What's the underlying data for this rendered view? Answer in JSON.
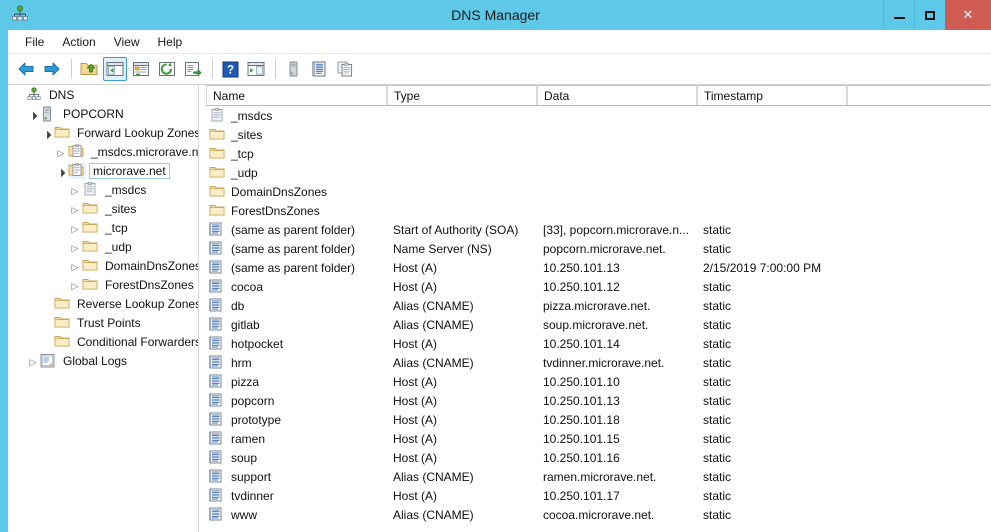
{
  "window": {
    "title": "DNS Manager",
    "app_icon": "dns-server-icon",
    "controls": {
      "minimize": "–",
      "maximize": "□",
      "close": "✕"
    },
    "accent_color": "#5ec8e8",
    "close_color": "#cf5b52"
  },
  "menubar": {
    "items": [
      {
        "label": "File",
        "name": "menu-file"
      },
      {
        "label": "Action",
        "name": "menu-action"
      },
      {
        "label": "View",
        "name": "menu-view"
      },
      {
        "label": "Help",
        "name": "menu-help"
      }
    ]
  },
  "toolbar": {
    "buttons": [
      {
        "name": "back-icon",
        "icon": "arrow-left",
        "active": false
      },
      {
        "name": "forward-icon",
        "icon": "arrow-right",
        "active": false
      },
      {
        "name": "separator-1",
        "icon": "separator",
        "active": false
      },
      {
        "name": "up-one-level-icon",
        "icon": "folder-up",
        "active": false
      },
      {
        "name": "show-hide-console-tree-icon",
        "icon": "console-tree",
        "active": true
      },
      {
        "name": "properties-icon",
        "icon": "properties",
        "active": false
      },
      {
        "name": "refresh-icon",
        "icon": "refresh",
        "active": false
      },
      {
        "name": "export-list-icon",
        "icon": "export-list",
        "active": false
      },
      {
        "name": "separator-2",
        "icon": "separator",
        "active": false
      },
      {
        "name": "help-icon",
        "icon": "help",
        "active": false
      },
      {
        "name": "show-hide-action-pane-icon",
        "icon": "action-pane",
        "active": false
      },
      {
        "name": "separator-3",
        "icon": "separator",
        "active": false
      },
      {
        "name": "new-server-icon",
        "icon": "server",
        "active": false
      },
      {
        "name": "new-record-icon",
        "icon": "record",
        "active": false
      },
      {
        "name": "copy-icon",
        "icon": "copy",
        "active": false
      }
    ]
  },
  "tree": {
    "items": [
      {
        "label": "DNS",
        "depth": 0,
        "arrow": "none",
        "icon": "dns-root-icon",
        "selected": false,
        "name": "tree-item-dns"
      },
      {
        "label": "POPCORN",
        "depth": 1,
        "arrow": "open",
        "icon": "server-icon",
        "selected": false,
        "name": "tree-item-popcorn"
      },
      {
        "label": "Forward Lookup Zones",
        "depth": 2,
        "arrow": "open",
        "icon": "folder-icon",
        "selected": false,
        "name": "tree-item-forward-lookup-zones"
      },
      {
        "label": "_msdcs.microrave.net",
        "depth": 3,
        "arrow": "closed",
        "icon": "zone-icon",
        "selected": false,
        "name": "tree-item-msdcs-microrave-net"
      },
      {
        "label": "microrave.net",
        "depth": 3,
        "arrow": "open",
        "icon": "zone-icon",
        "selected": true,
        "name": "tree-item-microrave-net"
      },
      {
        "label": "_msdcs",
        "depth": 4,
        "arrow": "closed",
        "icon": "zone-gray-icon",
        "selected": false,
        "name": "tree-item-msdcs"
      },
      {
        "label": "_sites",
        "depth": 4,
        "arrow": "closed",
        "icon": "folder-icon",
        "selected": false,
        "name": "tree-item-sites"
      },
      {
        "label": "_tcp",
        "depth": 4,
        "arrow": "closed",
        "icon": "folder-icon",
        "selected": false,
        "name": "tree-item-tcp"
      },
      {
        "label": "_udp",
        "depth": 4,
        "arrow": "closed",
        "icon": "folder-icon",
        "selected": false,
        "name": "tree-item-udp"
      },
      {
        "label": "DomainDnsZones",
        "depth": 4,
        "arrow": "closed",
        "icon": "folder-icon",
        "selected": false,
        "name": "tree-item-domaindnszones"
      },
      {
        "label": "ForestDnsZones",
        "depth": 4,
        "arrow": "closed",
        "icon": "folder-icon",
        "selected": false,
        "name": "tree-item-forestdnszones"
      },
      {
        "label": "Reverse Lookup Zones",
        "depth": 2,
        "arrow": "none",
        "icon": "folder-icon",
        "selected": false,
        "name": "tree-item-reverse-lookup-zones"
      },
      {
        "label": "Trust Points",
        "depth": 2,
        "arrow": "none",
        "icon": "folder-icon",
        "selected": false,
        "name": "tree-item-trust-points"
      },
      {
        "label": "Conditional Forwarders",
        "depth": 2,
        "arrow": "none",
        "icon": "folder-icon",
        "selected": false,
        "name": "tree-item-conditional-forwarders"
      },
      {
        "label": "Global Logs",
        "depth": 1,
        "arrow": "closed",
        "icon": "global-logs-icon",
        "selected": false,
        "name": "tree-item-global-logs"
      }
    ]
  },
  "list": {
    "columns": [
      {
        "label": "Name",
        "width": 181,
        "name": "column-header-name"
      },
      {
        "label": "Type",
        "width": 150,
        "name": "column-header-type"
      },
      {
        "label": "Data",
        "width": 160,
        "name": "column-header-data"
      },
      {
        "label": "Timestamp",
        "width": 150,
        "name": "column-header-timestamp"
      },
      {
        "label": "",
        "width": 143,
        "name": "column-header-filler"
      }
    ],
    "rows": [
      {
        "icon": "zone-gray-icon",
        "name": "_msdcs",
        "type": "",
        "data": "",
        "timestamp": ""
      },
      {
        "icon": "folder-icon",
        "name": "_sites",
        "type": "",
        "data": "",
        "timestamp": ""
      },
      {
        "icon": "folder-icon",
        "name": "_tcp",
        "type": "",
        "data": "",
        "timestamp": ""
      },
      {
        "icon": "folder-icon",
        "name": "_udp",
        "type": "",
        "data": "",
        "timestamp": ""
      },
      {
        "icon": "folder-icon",
        "name": "DomainDnsZones",
        "type": "",
        "data": "",
        "timestamp": ""
      },
      {
        "icon": "folder-icon",
        "name": "ForestDnsZones",
        "type": "",
        "data": "",
        "timestamp": ""
      },
      {
        "icon": "record-icon",
        "name": "(same as parent folder)",
        "type": "Start of Authority (SOA)",
        "data": "[33], popcorn.microrave.n...",
        "timestamp": "static"
      },
      {
        "icon": "record-icon",
        "name": "(same as parent folder)",
        "type": "Name Server (NS)",
        "data": "popcorn.microrave.net.",
        "timestamp": "static"
      },
      {
        "icon": "record-icon",
        "name": "(same as parent folder)",
        "type": "Host (A)",
        "data": "10.250.101.13",
        "timestamp": "2/15/2019 7:00:00 PM"
      },
      {
        "icon": "record-icon",
        "name": "cocoa",
        "type": "Host (A)",
        "data": "10.250.101.12",
        "timestamp": "static"
      },
      {
        "icon": "record-icon",
        "name": "db",
        "type": "Alias (CNAME)",
        "data": "pizza.microrave.net.",
        "timestamp": "static"
      },
      {
        "icon": "record-icon",
        "name": "gitlab",
        "type": "Alias (CNAME)",
        "data": "soup.microrave.net.",
        "timestamp": "static"
      },
      {
        "icon": "record-icon",
        "name": "hotpocket",
        "type": "Host (A)",
        "data": "10.250.101.14",
        "timestamp": "static"
      },
      {
        "icon": "record-icon",
        "name": "hrm",
        "type": "Alias (CNAME)",
        "data": "tvdinner.microrave.net.",
        "timestamp": "static"
      },
      {
        "icon": "record-icon",
        "name": "pizza",
        "type": "Host (A)",
        "data": "10.250.101.10",
        "timestamp": "static"
      },
      {
        "icon": "record-icon",
        "name": "popcorn",
        "type": "Host (A)",
        "data": "10.250.101.13",
        "timestamp": "static"
      },
      {
        "icon": "record-icon",
        "name": "prototype",
        "type": "Host (A)",
        "data": "10.250.101.18",
        "timestamp": "static"
      },
      {
        "icon": "record-icon",
        "name": "ramen",
        "type": "Host (A)",
        "data": "10.250.101.15",
        "timestamp": "static"
      },
      {
        "icon": "record-icon",
        "name": "soup",
        "type": "Host (A)",
        "data": "10.250.101.16",
        "timestamp": "static"
      },
      {
        "icon": "record-icon",
        "name": "support",
        "type": "Alias (CNAME)",
        "data": "ramen.microrave.net.",
        "timestamp": "static"
      },
      {
        "icon": "record-icon",
        "name": "tvdinner",
        "type": "Host (A)",
        "data": "10.250.101.17",
        "timestamp": "static"
      },
      {
        "icon": "record-icon",
        "name": "www",
        "type": "Alias (CNAME)",
        "data": "cocoa.microrave.net.",
        "timestamp": "static"
      }
    ]
  }
}
